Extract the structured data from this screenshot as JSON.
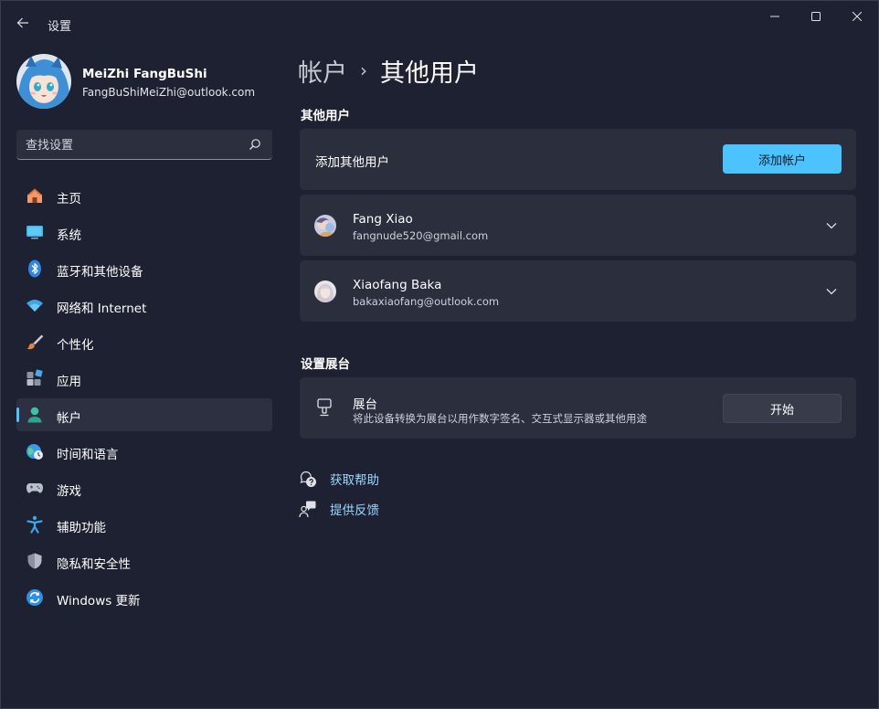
{
  "app": {
    "title": "设置"
  },
  "profile": {
    "name": "MeiZhi FangBuShi",
    "email": "FangBuShiMeiZhi@outlook.com"
  },
  "search": {
    "placeholder": "查找设置"
  },
  "sidebar": {
    "items": [
      {
        "label": "主页",
        "icon": "home-icon",
        "active": false
      },
      {
        "label": "系统",
        "icon": "monitor-icon",
        "active": false
      },
      {
        "label": "蓝牙和其他设备",
        "icon": "bluetooth-icon",
        "active": false
      },
      {
        "label": "网络和 Internet",
        "icon": "wifi-icon",
        "active": false
      },
      {
        "label": "个性化",
        "icon": "brush-icon",
        "active": false
      },
      {
        "label": "应用",
        "icon": "apps-icon",
        "active": false
      },
      {
        "label": "帐户",
        "icon": "person-icon",
        "active": true
      },
      {
        "label": "时间和语言",
        "icon": "globe-clock-icon",
        "active": false
      },
      {
        "label": "游戏",
        "icon": "gamepad-icon",
        "active": false
      },
      {
        "label": "辅助功能",
        "icon": "accessibility-icon",
        "active": false
      },
      {
        "label": "隐私和安全性",
        "icon": "shield-icon",
        "active": false
      },
      {
        "label": "Windows 更新",
        "icon": "update-icon",
        "active": false
      }
    ]
  },
  "breadcrumb": {
    "parent": "帐户",
    "separator": "›",
    "current": "其他用户"
  },
  "other_users": {
    "section_title": "其他用户",
    "add_label": "添加其他用户",
    "add_button": "添加帐户",
    "users": [
      {
        "name": "Fang Xiao",
        "email": "fangnude520@gmail.com"
      },
      {
        "name": "Xiaofang Baka",
        "email": "bakaxiaofang@outlook.com"
      }
    ]
  },
  "kiosk": {
    "section_title": "设置展台",
    "title": "展台",
    "description": "将此设备转换为展台以用作数字签名、交互式显示器或其他用途",
    "button": "开始"
  },
  "links": {
    "help": "获取帮助",
    "feedback": "提供反馈"
  },
  "colors": {
    "accent": "#4cc2ff",
    "background": "#1d2131",
    "card": "#2a2e3d",
    "link": "#9ad8ff"
  }
}
